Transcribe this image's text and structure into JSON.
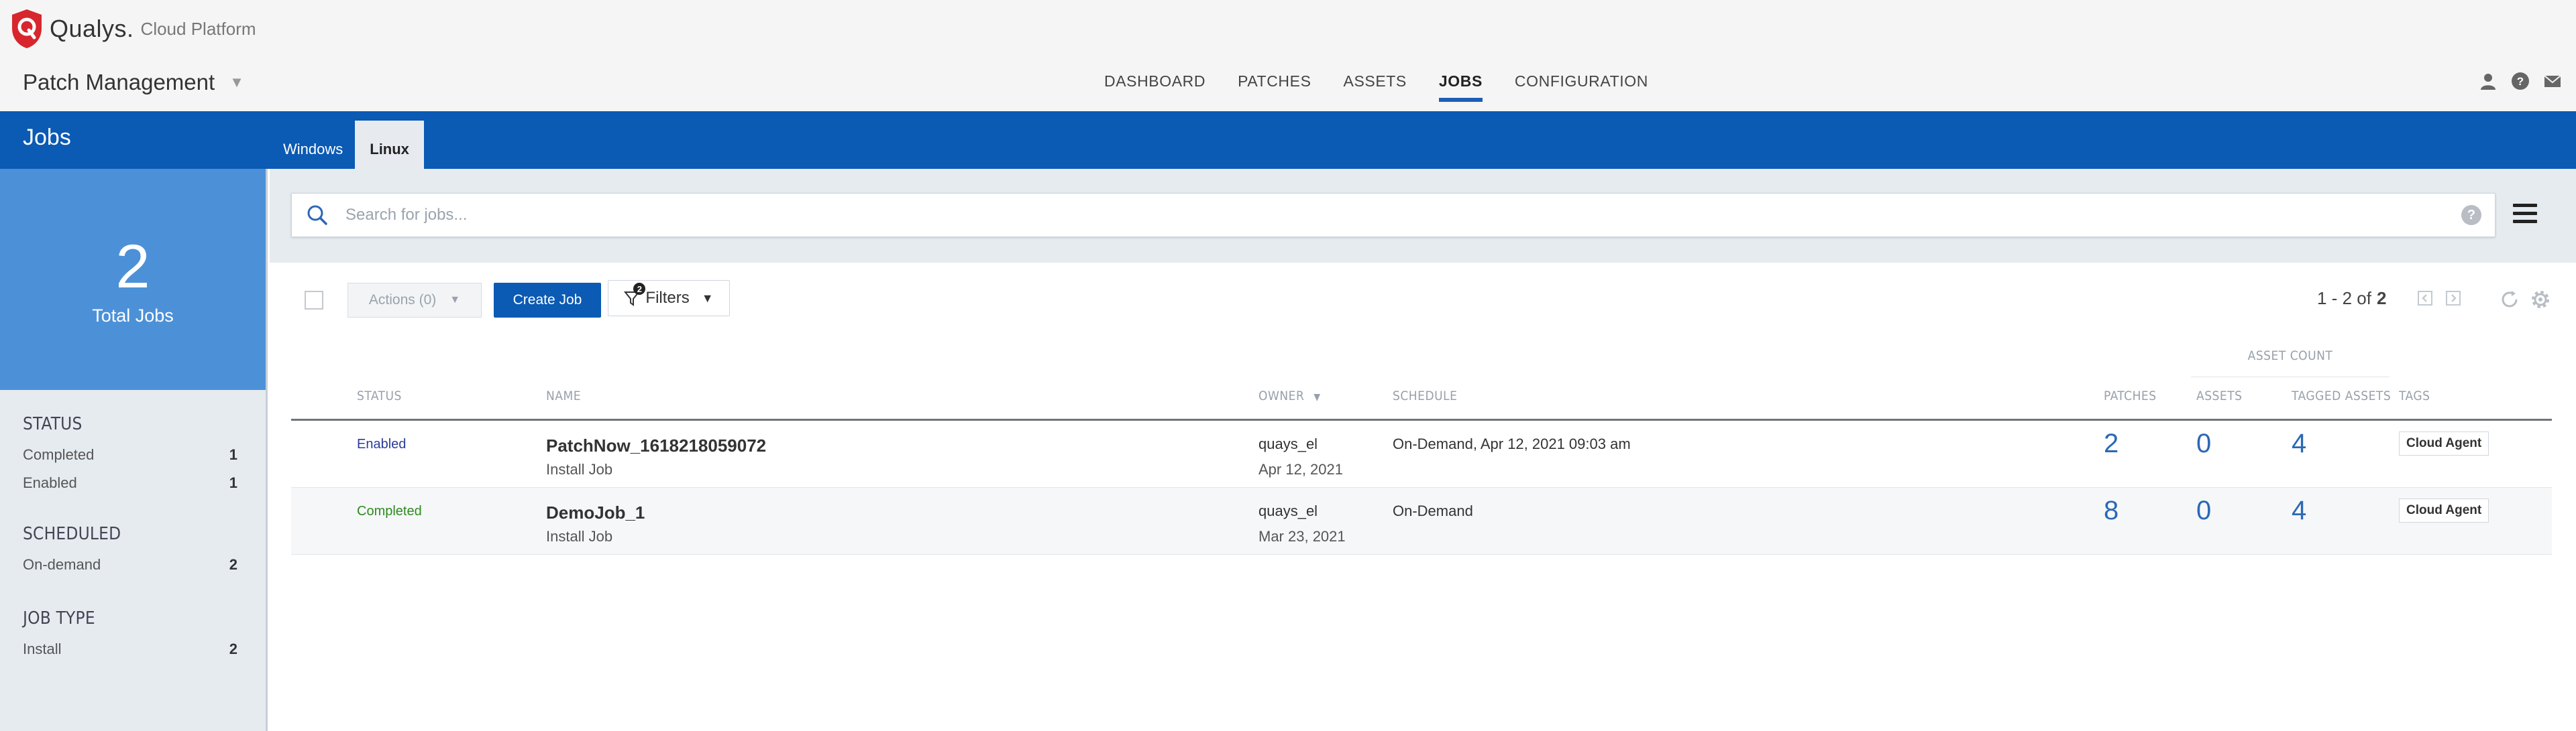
{
  "brand": {
    "name": "Qualys.",
    "subtitle": "Cloud Platform"
  },
  "module": {
    "name": "Patch Management",
    "caret": "▼"
  },
  "nav": {
    "items": [
      "DASHBOARD",
      "PATCHES",
      "ASSETS",
      "JOBS",
      "CONFIGURATION"
    ],
    "active": "JOBS"
  },
  "page": {
    "title": "Jobs",
    "subtabs": [
      "Windows",
      "Linux"
    ],
    "active_subtab": "Linux"
  },
  "kpi": {
    "count": "2",
    "label": "Total Jobs"
  },
  "facets": [
    {
      "title": "STATUS",
      "rows": [
        {
          "label": "Completed",
          "count": "1"
        },
        {
          "label": "Enabled",
          "count": "1"
        }
      ]
    },
    {
      "title": "SCHEDULED",
      "rows": [
        {
          "label": "On-demand",
          "count": "2"
        }
      ]
    },
    {
      "title": "JOB TYPE",
      "rows": [
        {
          "label": "Install",
          "count": "2"
        }
      ]
    }
  ],
  "search": {
    "placeholder": "Search for jobs...",
    "help": "?"
  },
  "toolbar": {
    "actions_label": "Actions (0)",
    "create_label": "Create Job",
    "filters_label": "Filters",
    "filters_badge": "2",
    "pager_range": "1 - 2 of",
    "pager_total": "2"
  },
  "table": {
    "group_header": "ASSET COUNT",
    "columns": {
      "status": "STATUS",
      "name": "NAME",
      "owner": "OWNER",
      "schedule": "SCHEDULE",
      "patches": "PATCHES",
      "assets": "ASSETS",
      "tagged_assets": "TAGGED ASSETS",
      "tags": "TAGS"
    },
    "rows": [
      {
        "status": "Enabled",
        "name": "PatchNow_1618218059072",
        "type": "Install Job",
        "owner": "quays_el",
        "owner_date": "Apr 12, 2021",
        "schedule": "On-Demand, Apr 12, 2021 09:03 am",
        "patches": "2",
        "assets": "0",
        "tagged_assets": "4",
        "tag": "Cloud Agent"
      },
      {
        "status": "Completed",
        "name": "DemoJob_1",
        "type": "Install Job",
        "owner": "quays_el",
        "owner_date": "Mar 23, 2021",
        "schedule": "On-Demand",
        "patches": "8",
        "assets": "0",
        "tagged_assets": "4",
        "tag": "Cloud Agent"
      }
    ]
  },
  "colors": {
    "brand_blue": "#0b5ab4",
    "kpi_blue": "#4c91d8",
    "logo_red": "#d7262d",
    "link_blue": "#2b68b5",
    "status_enabled": "#2a3c98",
    "status_completed": "#2e8b1e"
  },
  "icons": [
    "qualys-shield-logo",
    "user-icon",
    "help-icon",
    "mail-icon",
    "search-icon",
    "menu-icon",
    "filter-icon",
    "chevron-left-icon",
    "chevron-right-icon",
    "refresh-icon",
    "gear-icon"
  ]
}
